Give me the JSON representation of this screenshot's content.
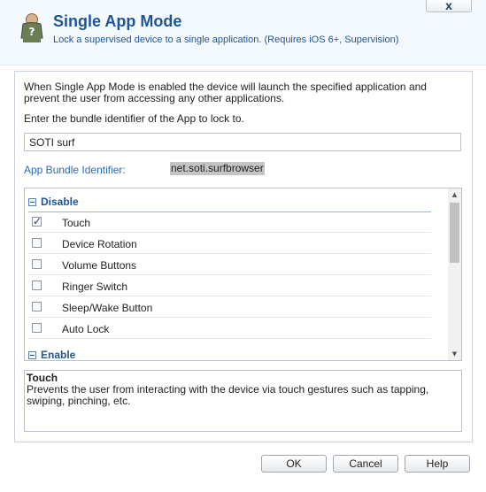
{
  "window": {
    "close_label": "x",
    "title": "Single App Mode",
    "subtitle": "Lock a supervised device to a single application. (Requires iOS 6+, Supervision)",
    "icon": "user-question-icon"
  },
  "form": {
    "description": "When Single App Mode is enabled the device will launch the specified application and prevent the user from accessing any other applications.",
    "enter_label": "Enter the bundle identifier of the App to lock to.",
    "app_name_value": "SOTI surf",
    "bundle_label": "App Bundle Identifier:",
    "bundle_value": "net.soti.surfbrowser"
  },
  "options": {
    "disable_group": "Disable",
    "enable_group": "Enable",
    "items": [
      {
        "label": "Touch",
        "checked": true
      },
      {
        "label": "Device Rotation",
        "checked": false
      },
      {
        "label": "Volume Buttons",
        "checked": false
      },
      {
        "label": "Ringer Switch",
        "checked": false
      },
      {
        "label": "Sleep/Wake Button",
        "checked": false
      },
      {
        "label": "Auto Lock",
        "checked": false
      }
    ]
  },
  "help": {
    "title": "Touch",
    "text": "Prevents the user from interacting with the device via touch gestures such as tapping, swiping, pinching, etc."
  },
  "buttons": {
    "ok": "OK",
    "cancel": "Cancel",
    "help": "Help"
  },
  "colors": {
    "accent": "#1e5596",
    "link": "#2a6bb0",
    "highlight": "#c4c4c4"
  }
}
